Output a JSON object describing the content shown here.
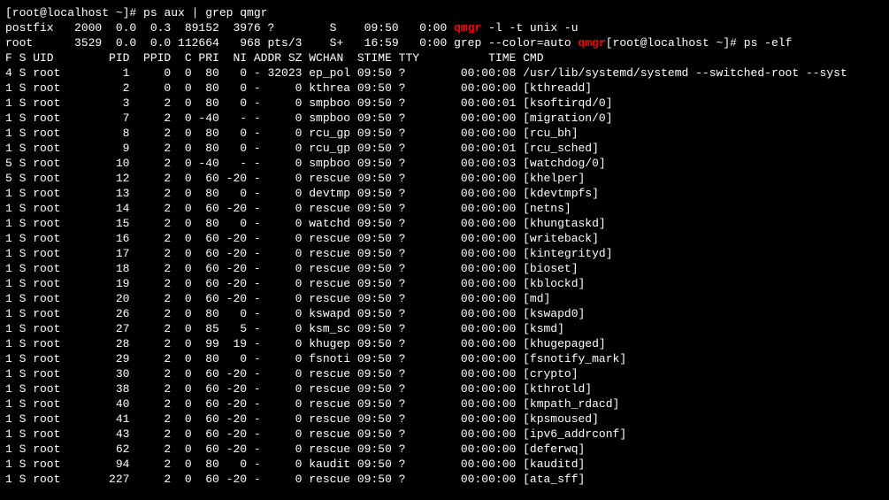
{
  "prompt1_pre": "[root@localhost ~]#",
  "cmd1": " ps aux | grep qmgr",
  "grep_lines": [
    {
      "raw_pre": "postfix   2000  0.0  0.3  89152  3976 ?        S    09:50   0:00 ",
      "hl": "qmgr",
      "raw_post": " -l -t unix -u"
    },
    {
      "raw_pre": "root      3529  0.0  0.0 112664   968 pts/3    S+   16:59   0:00 grep --color=auto ",
      "hl": "qmgr",
      "raw_post": ""
    }
  ],
  "prompt2_pre": "[root@localhost ~]#",
  "cmd2": " ps -elf",
  "elf_header": "F S UID        PID  PPID  C PRI  NI ADDR SZ WCHAN  STIME TTY          TIME CMD",
  "elf_rows": [
    "4 S root         1     0  0  80   0 - 32023 ep_pol 09:50 ?        00:00:08 /usr/lib/systemd/systemd --switched-root --syst",
    "1 S root         2     0  0  80   0 -     0 kthrea 09:50 ?        00:00:00 [kthreadd]",
    "1 S root         3     2  0  80   0 -     0 smpboo 09:50 ?        00:00:01 [ksoftirqd/0]",
    "1 S root         7     2  0 -40   - -     0 smpboo 09:50 ?        00:00:00 [migration/0]",
    "1 S root         8     2  0  80   0 -     0 rcu_gp 09:50 ?        00:00:00 [rcu_bh]",
    "1 S root         9     2  0  80   0 -     0 rcu_gp 09:50 ?        00:00:01 [rcu_sched]",
    "5 S root        10     2  0 -40   - -     0 smpboo 09:50 ?        00:00:03 [watchdog/0]",
    "5 S root        12     2  0  60 -20 -     0 rescue 09:50 ?        00:00:00 [khelper]",
    "1 S root        13     2  0  80   0 -     0 devtmp 09:50 ?        00:00:00 [kdevtmpfs]",
    "1 S root        14     2  0  60 -20 -     0 rescue 09:50 ?        00:00:00 [netns]",
    "1 S root        15     2  0  80   0 -     0 watchd 09:50 ?        00:00:00 [khungtaskd]",
    "1 S root        16     2  0  60 -20 -     0 rescue 09:50 ?        00:00:00 [writeback]",
    "1 S root        17     2  0  60 -20 -     0 rescue 09:50 ?        00:00:00 [kintegrityd]",
    "1 S root        18     2  0  60 -20 -     0 rescue 09:50 ?        00:00:00 [bioset]",
    "1 S root        19     2  0  60 -20 -     0 rescue 09:50 ?        00:00:00 [kblockd]",
    "1 S root        20     2  0  60 -20 -     0 rescue 09:50 ?        00:00:00 [md]",
    "1 S root        26     2  0  80   0 -     0 kswapd 09:50 ?        00:00:00 [kswapd0]",
    "1 S root        27     2  0  85   5 -     0 ksm_sc 09:50 ?        00:00:00 [ksmd]",
    "1 S root        28     2  0  99  19 -     0 khugep 09:50 ?        00:00:00 [khugepaged]",
    "1 S root        29     2  0  80   0 -     0 fsnoti 09:50 ?        00:00:00 [fsnotify_mark]",
    "1 S root        30     2  0  60 -20 -     0 rescue 09:50 ?        00:00:00 [crypto]",
    "1 S root        38     2  0  60 -20 -     0 rescue 09:50 ?        00:00:00 [kthrotld]",
    "1 S root        40     2  0  60 -20 -     0 rescue 09:50 ?        00:00:00 [kmpath_rdacd]",
    "1 S root        41     2  0  60 -20 -     0 rescue 09:50 ?        00:00:00 [kpsmoused]",
    "1 S root        43     2  0  60 -20 -     0 rescue 09:50 ?        00:00:00 [ipv6_addrconf]",
    "1 S root        62     2  0  60 -20 -     0 rescue 09:50 ?        00:00:00 [deferwq]",
    "1 S root        94     2  0  80   0 -     0 kaudit 09:50 ?        00:00:00 [kauditd]",
    "1 S root       227     2  0  60 -20 -     0 rescue 09:50 ?        00:00:00 [ata_sff]"
  ]
}
